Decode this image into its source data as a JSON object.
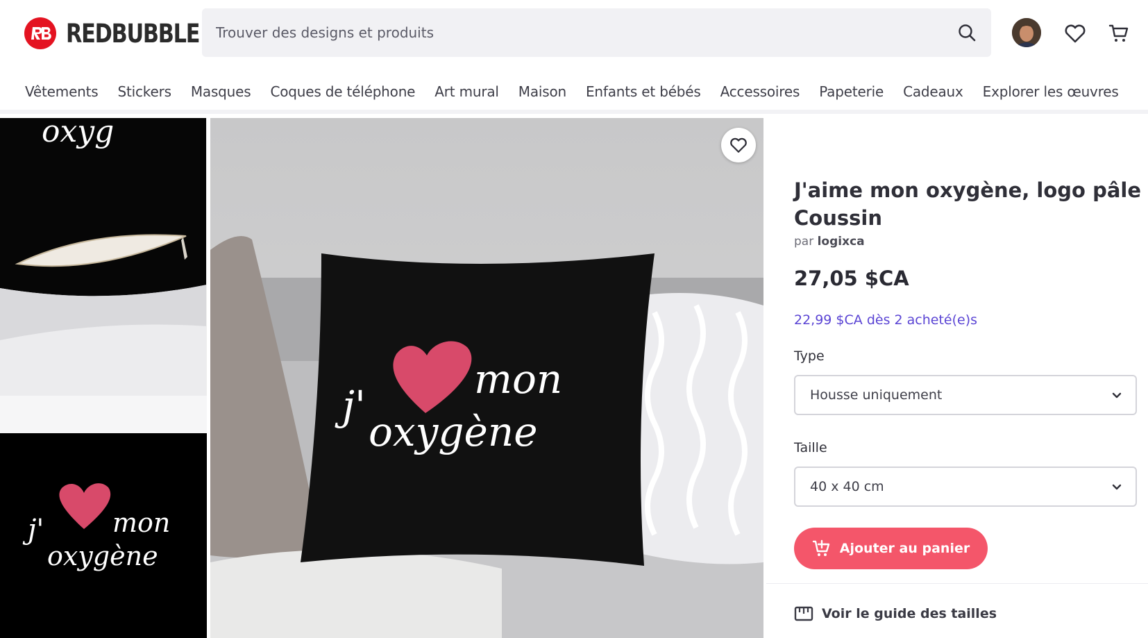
{
  "brand": {
    "name": "REDBUBBLE",
    "color": "#e41321"
  },
  "search": {
    "placeholder": "Trouver des designs et produits",
    "icon": "search-icon"
  },
  "header_icons": [
    "avatar",
    "heart-icon",
    "cart-icon"
  ],
  "nav": {
    "items": [
      "Vêtements",
      "Stickers",
      "Masques",
      "Coques de téléphone",
      "Art mural",
      "Maison",
      "Enfants et bébés",
      "Accessoires",
      "Papeterie",
      "Cadeaux",
      "Explorer les œuvres"
    ]
  },
  "gallery": {
    "design_text_line1": "j'",
    "design_text_mon": "mon",
    "design_text_line2": "oxygène",
    "thumb_top_text": "oxyg"
  },
  "product": {
    "title": "J'aime mon oxygène, logo pâle Coussin",
    "by_prefix": "par",
    "author": "logixca",
    "price": "27,05 $CA",
    "bulk_price": "22,99 $CA dès 2 acheté(e)s",
    "type_label": "Type",
    "type_value": "Housse uniquement",
    "size_label": "Taille",
    "size_value": "40 x 40 cm",
    "add_to_cart": "Ajouter au panier",
    "size_guide": "Voir le guide des tailles"
  },
  "colors": {
    "accent": "#f4566a",
    "bulk": "#5a44d4",
    "heart": "#d8405b"
  }
}
